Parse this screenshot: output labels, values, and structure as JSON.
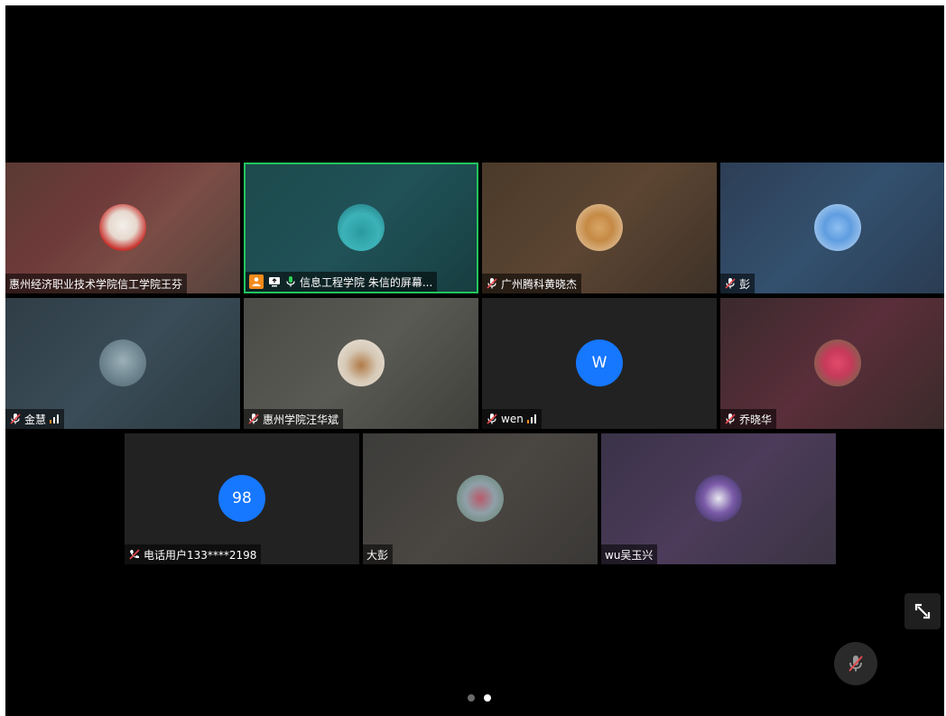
{
  "tiles": [
    {
      "name": "惠州经济职业技术学院信工学院王芬"
    },
    {
      "name": "信息工程学院 朱信的屏幕..."
    },
    {
      "name": "广州腾科黄晓杰"
    },
    {
      "name": "彭"
    },
    {
      "name": "金慧"
    },
    {
      "name": "惠州学院汪华斌"
    },
    {
      "name": "wen",
      "avatar_letter": "W"
    },
    {
      "name": "乔晓华"
    },
    {
      "name": "电话用户133****2198",
      "avatar_letter": "98"
    },
    {
      "name": "大彭"
    },
    {
      "name": "wu吴玉兴"
    }
  ],
  "colors": {
    "active_border": "#22c55e",
    "avatar_blue": "#1677ff",
    "presenter_orange": "#f38b1c",
    "mic_off_red": "#e5484d"
  },
  "pagination": {
    "total": 2,
    "current": 2
  }
}
